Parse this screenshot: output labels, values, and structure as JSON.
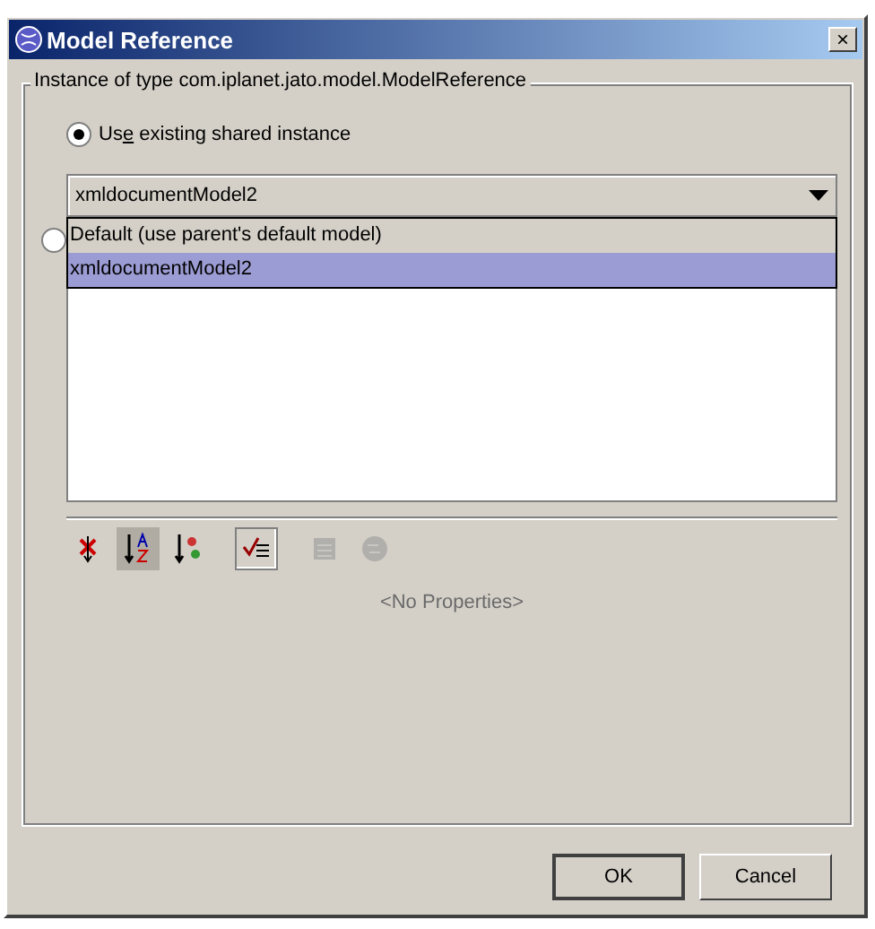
{
  "window": {
    "title": "Model Reference",
    "close": "×"
  },
  "group": {
    "title": "Instance of type com.iplanet.jato.model.ModelReference"
  },
  "radios": [
    {
      "label": {
        "before": "Us",
        "mnemonic": "e",
        "after": " existing shared instance"
      },
      "selected": true
    },
    {
      "selected": false
    }
  ],
  "combo": {
    "value": "xmldocumentModel2",
    "expanded": true,
    "options": [
      {
        "label": "Default (use parent's default model)",
        "selected": false
      },
      {
        "label": "xmldocumentModel2",
        "selected": true
      }
    ]
  },
  "toolbar": [
    {
      "kind": "unsorted",
      "selected": false,
      "disabled": false
    },
    {
      "kind": "sort-name",
      "selected": true,
      "disabled": false
    },
    {
      "kind": "sort-type",
      "selected": false,
      "disabled": false
    },
    {
      "kind": "editable",
      "selected": true,
      "disabled": false
    },
    {
      "kind": "sheet",
      "selected": false,
      "disabled": true
    },
    {
      "kind": "help",
      "selected": false,
      "disabled": true
    }
  ],
  "empty_message": "<No Properties>",
  "buttons": [
    {
      "label": "OK",
      "default": true
    },
    {
      "label": "Cancel",
      "default": false
    }
  ]
}
